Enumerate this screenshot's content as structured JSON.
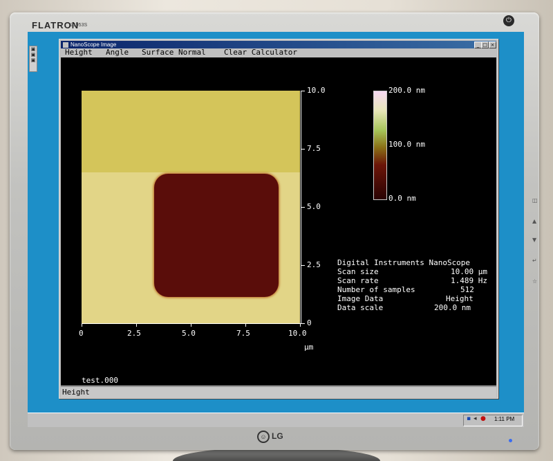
{
  "monitor": {
    "brand": "FLATRON",
    "model": "L1953S",
    "logo": "LG"
  },
  "window": {
    "title": "NanoScope Image",
    "menu": [
      "Height",
      "Angle",
      "Surface Normal",
      "Clear Calculator"
    ],
    "status": "Height"
  },
  "image": {
    "y_ticks": [
      "10.0",
      "7.5",
      "5.0",
      "2.5",
      "0"
    ],
    "x_ticks": [
      "0",
      "2.5",
      "5.0",
      "7.5",
      "10.0"
    ],
    "x_unit": "µm",
    "filename": "test.000",
    "colors": {
      "substrate_top": "#d4c55a",
      "substrate_bottom": "#e2d587",
      "pit": "#5a0d0a"
    }
  },
  "colorbar": {
    "max": "200.0 nm",
    "mid": "100.0 nm",
    "min": "0.0 nm"
  },
  "info": {
    "header": "Digital Instruments NanoScope",
    "rows": [
      {
        "label": "Scan size",
        "value": "10.00 µm"
      },
      {
        "label": "Scan rate",
        "value": "1.489 Hz"
      },
      {
        "label": "Number of samples",
        "value": "512"
      },
      {
        "label": "Image Data",
        "value": "Height"
      },
      {
        "label": "Data scale",
        "value": "200.0 nm"
      }
    ]
  },
  "taskbar": {
    "time": "1:11 PM"
  }
}
